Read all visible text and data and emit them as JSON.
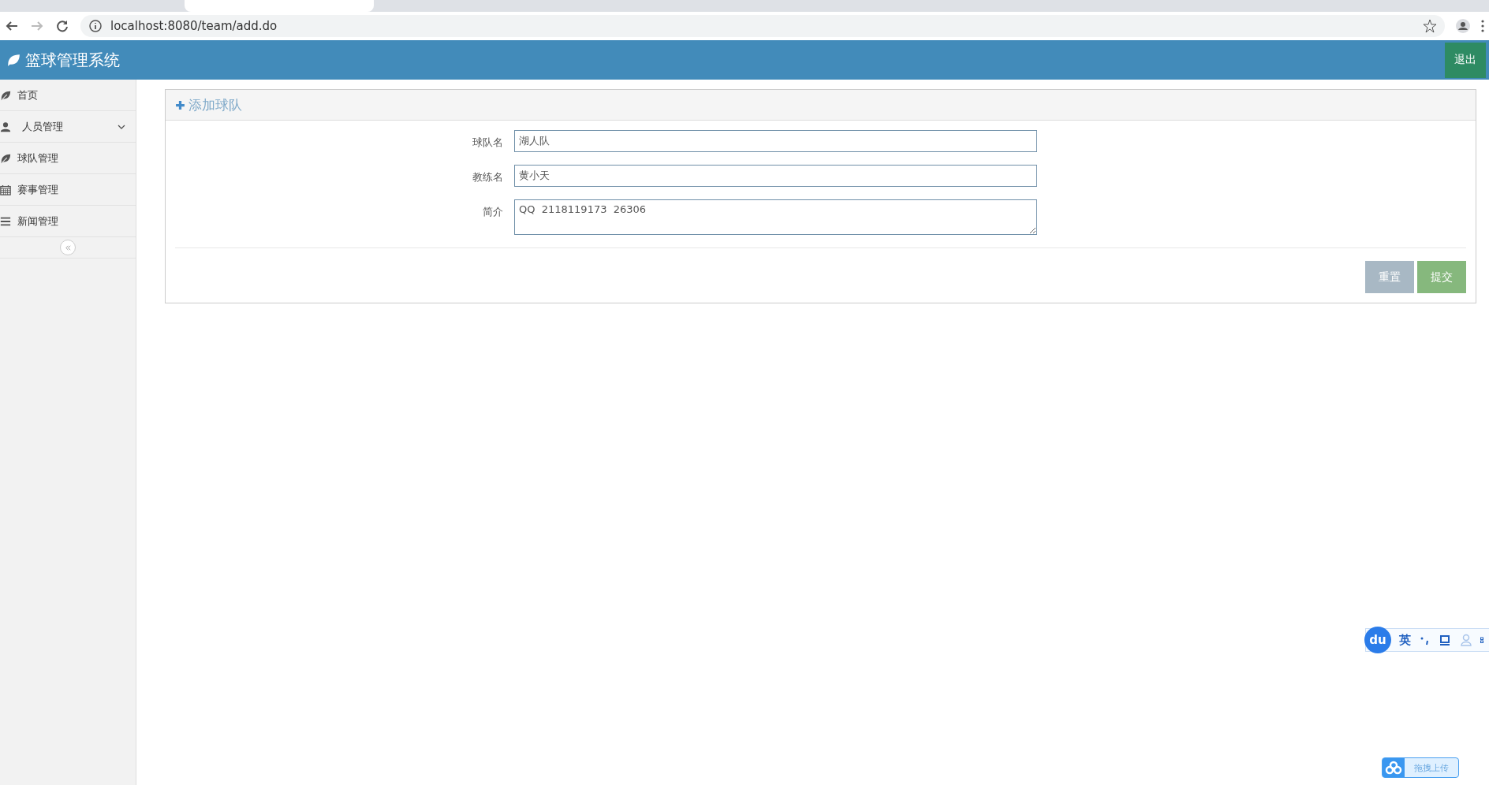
{
  "browser": {
    "url": "localhost:8080/team/add.do"
  },
  "header": {
    "title": "篮球管理系统",
    "logout": "退出"
  },
  "sidebar": {
    "items": [
      {
        "label": "首页",
        "kind": "leaf",
        "has_submenu": false
      },
      {
        "label": "人员管理",
        "kind": "user",
        "has_submenu": true
      },
      {
        "label": "球队管理",
        "kind": "leaf",
        "has_submenu": false
      },
      {
        "label": "赛事管理",
        "kind": "calendar",
        "has_submenu": false
      },
      {
        "label": "新闻管理",
        "kind": "list",
        "has_submenu": false
      }
    ]
  },
  "panel": {
    "title": "添加球队",
    "fields": [
      {
        "label": "球队名",
        "value": "湖人队",
        "kind": "input"
      },
      {
        "label": "教练名",
        "value": "黄小天",
        "kind": "input"
      },
      {
        "label": "简介",
        "value": "QQ  2118119173  26306",
        "kind": "textarea"
      }
    ],
    "buttons": [
      {
        "label": "重置",
        "kind": "reset"
      },
      {
        "label": "提交",
        "kind": "submit"
      }
    ]
  },
  "ime": {
    "logo": "du",
    "mode": "英"
  },
  "upload": {
    "label": "拖拽上传"
  }
}
